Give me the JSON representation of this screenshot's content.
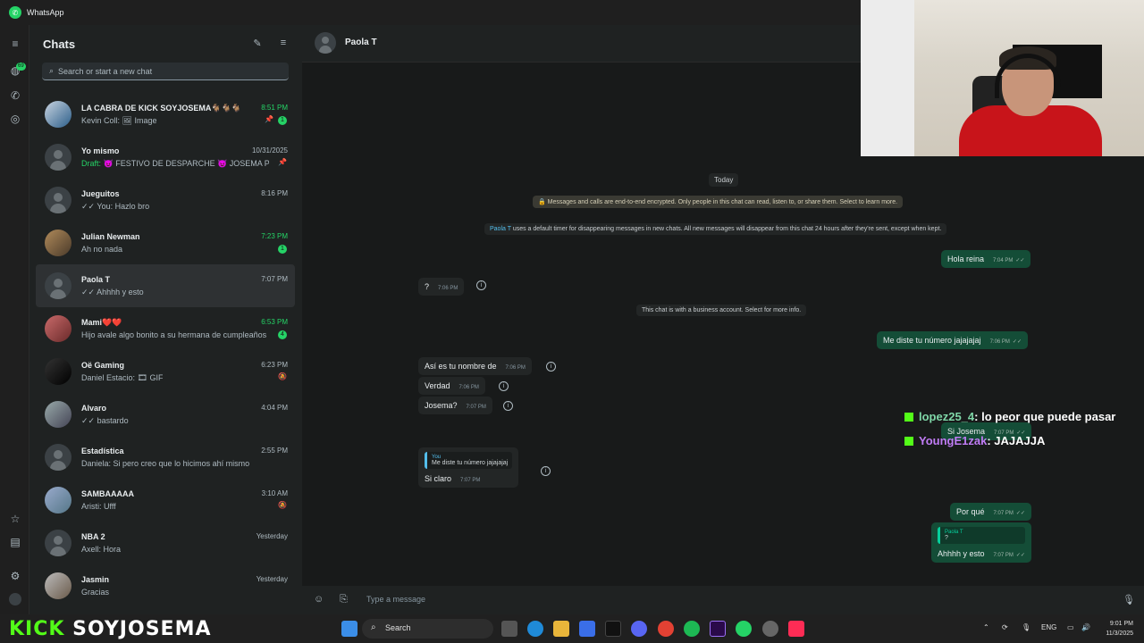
{
  "app": {
    "title": "WhatsApp"
  },
  "sidebar": {
    "title": "Chats",
    "search_placeholder": "Search or start a new chat",
    "chats": [
      {
        "name": "LA CABRA DE KICK SOYJOSEMA🐐🐐🐐",
        "time": "8:51 PM",
        "preview": "Kevin Coll: 🖼 Image",
        "unread": "1"
      },
      {
        "name": "Yo mismo",
        "time": "10/31/2025",
        "draft": "Draft:",
        "preview": "😈 FESTIVO DE DESPARCHE 😈 JOSEMA PRI..."
      },
      {
        "name": "Jueguitos",
        "time": "8:16 PM",
        "preview": "✓✓ You: Hazlo bro"
      },
      {
        "name": "Julian Newman",
        "time": "7:23 PM",
        "preview": "Ah no nada",
        "unread": "1"
      },
      {
        "name": "Paola T",
        "time": "7:07 PM",
        "preview": "✓✓ Ahhhh y esto"
      },
      {
        "name": "Mami❤️❤️",
        "time": "6:53 PM",
        "preview": "Hijo avale algo bonito a su hermana de cumpleaños",
        "unread": "4"
      },
      {
        "name": "Oë Gaming",
        "time": "6:23 PM",
        "preview": "Daniel Estacio: 🎞 GIF"
      },
      {
        "name": "Alvaro",
        "time": "4:04 PM",
        "preview": "✓✓ bastardo"
      },
      {
        "name": "Estadística",
        "time": "2:55 PM",
        "preview": "Daniela: Si pero creo que lo hicimos ahí mismo"
      },
      {
        "name": "SAMBAAAAA",
        "time": "3:10 AM",
        "preview": "Aristi: Ufff"
      },
      {
        "name": "NBA 2",
        "time": "Yesterday",
        "preview": "Axell: Hora"
      },
      {
        "name": "Jasmin",
        "time": "Yesterday",
        "preview": "Gracias"
      }
    ]
  },
  "rail": {
    "chats_badge": "69"
  },
  "conversation": {
    "contact": "Paola T",
    "date_pill": "Today",
    "encryption_notice": "🔒 Messages and calls are end-to-end encrypted. Only people in this chat can read, listen to, or share them. Select to learn more.",
    "disappearing_name": "Paola T",
    "disappearing_notice": "uses a default timer for disappearing messages in new chats. All new messages will disappear from this chat 24 hours after they're sent, except when kept.",
    "business_notice": "This chat is with a business account. Select for more info.",
    "messages": [
      {
        "dir": "out",
        "text": "Hola reina",
        "time": "7:04 PM"
      },
      {
        "dir": "in",
        "text": "?",
        "time": "7:06 PM"
      },
      {
        "dir": "out",
        "text": "Me diste tu número jajajajaj",
        "time": "7:06 PM"
      },
      {
        "dir": "in",
        "text": "Así es tu nombre de",
        "time": "7:06 PM"
      },
      {
        "dir": "in",
        "text": "Verdad",
        "time": "7:06 PM"
      },
      {
        "dir": "in",
        "text": "Josema?",
        "time": "7:07 PM"
      },
      {
        "dir": "in",
        "quote_name": "You",
        "quote_text": "Me diste tu número jajajajaj",
        "text": "Si claro",
        "time": "7:07 PM"
      },
      {
        "dir": "out",
        "text": "Si Josema",
        "time": "7:07 PM"
      },
      {
        "dir": "out",
        "text": "Por qué",
        "time": "7:07 PM"
      },
      {
        "dir": "out",
        "quote_name": "Paola T",
        "quote_text": "?",
        "text": "Ahhhh y esto",
        "time": "7:07 PM"
      }
    ],
    "composer_placeholder": "Type a message"
  },
  "stream": {
    "chat": [
      {
        "user": "lopez25_4",
        "text": ": lo peor que puede pasar"
      },
      {
        "user": "YoungE1zak",
        "text": ": JAJAJJA"
      }
    ],
    "logo_kick": "KICK",
    "logo_name": "SOYJOSEMA"
  },
  "taskbar": {
    "search": "Search",
    "lang": "ENG",
    "time": "9:01 PM",
    "date": "11/3/2025"
  }
}
